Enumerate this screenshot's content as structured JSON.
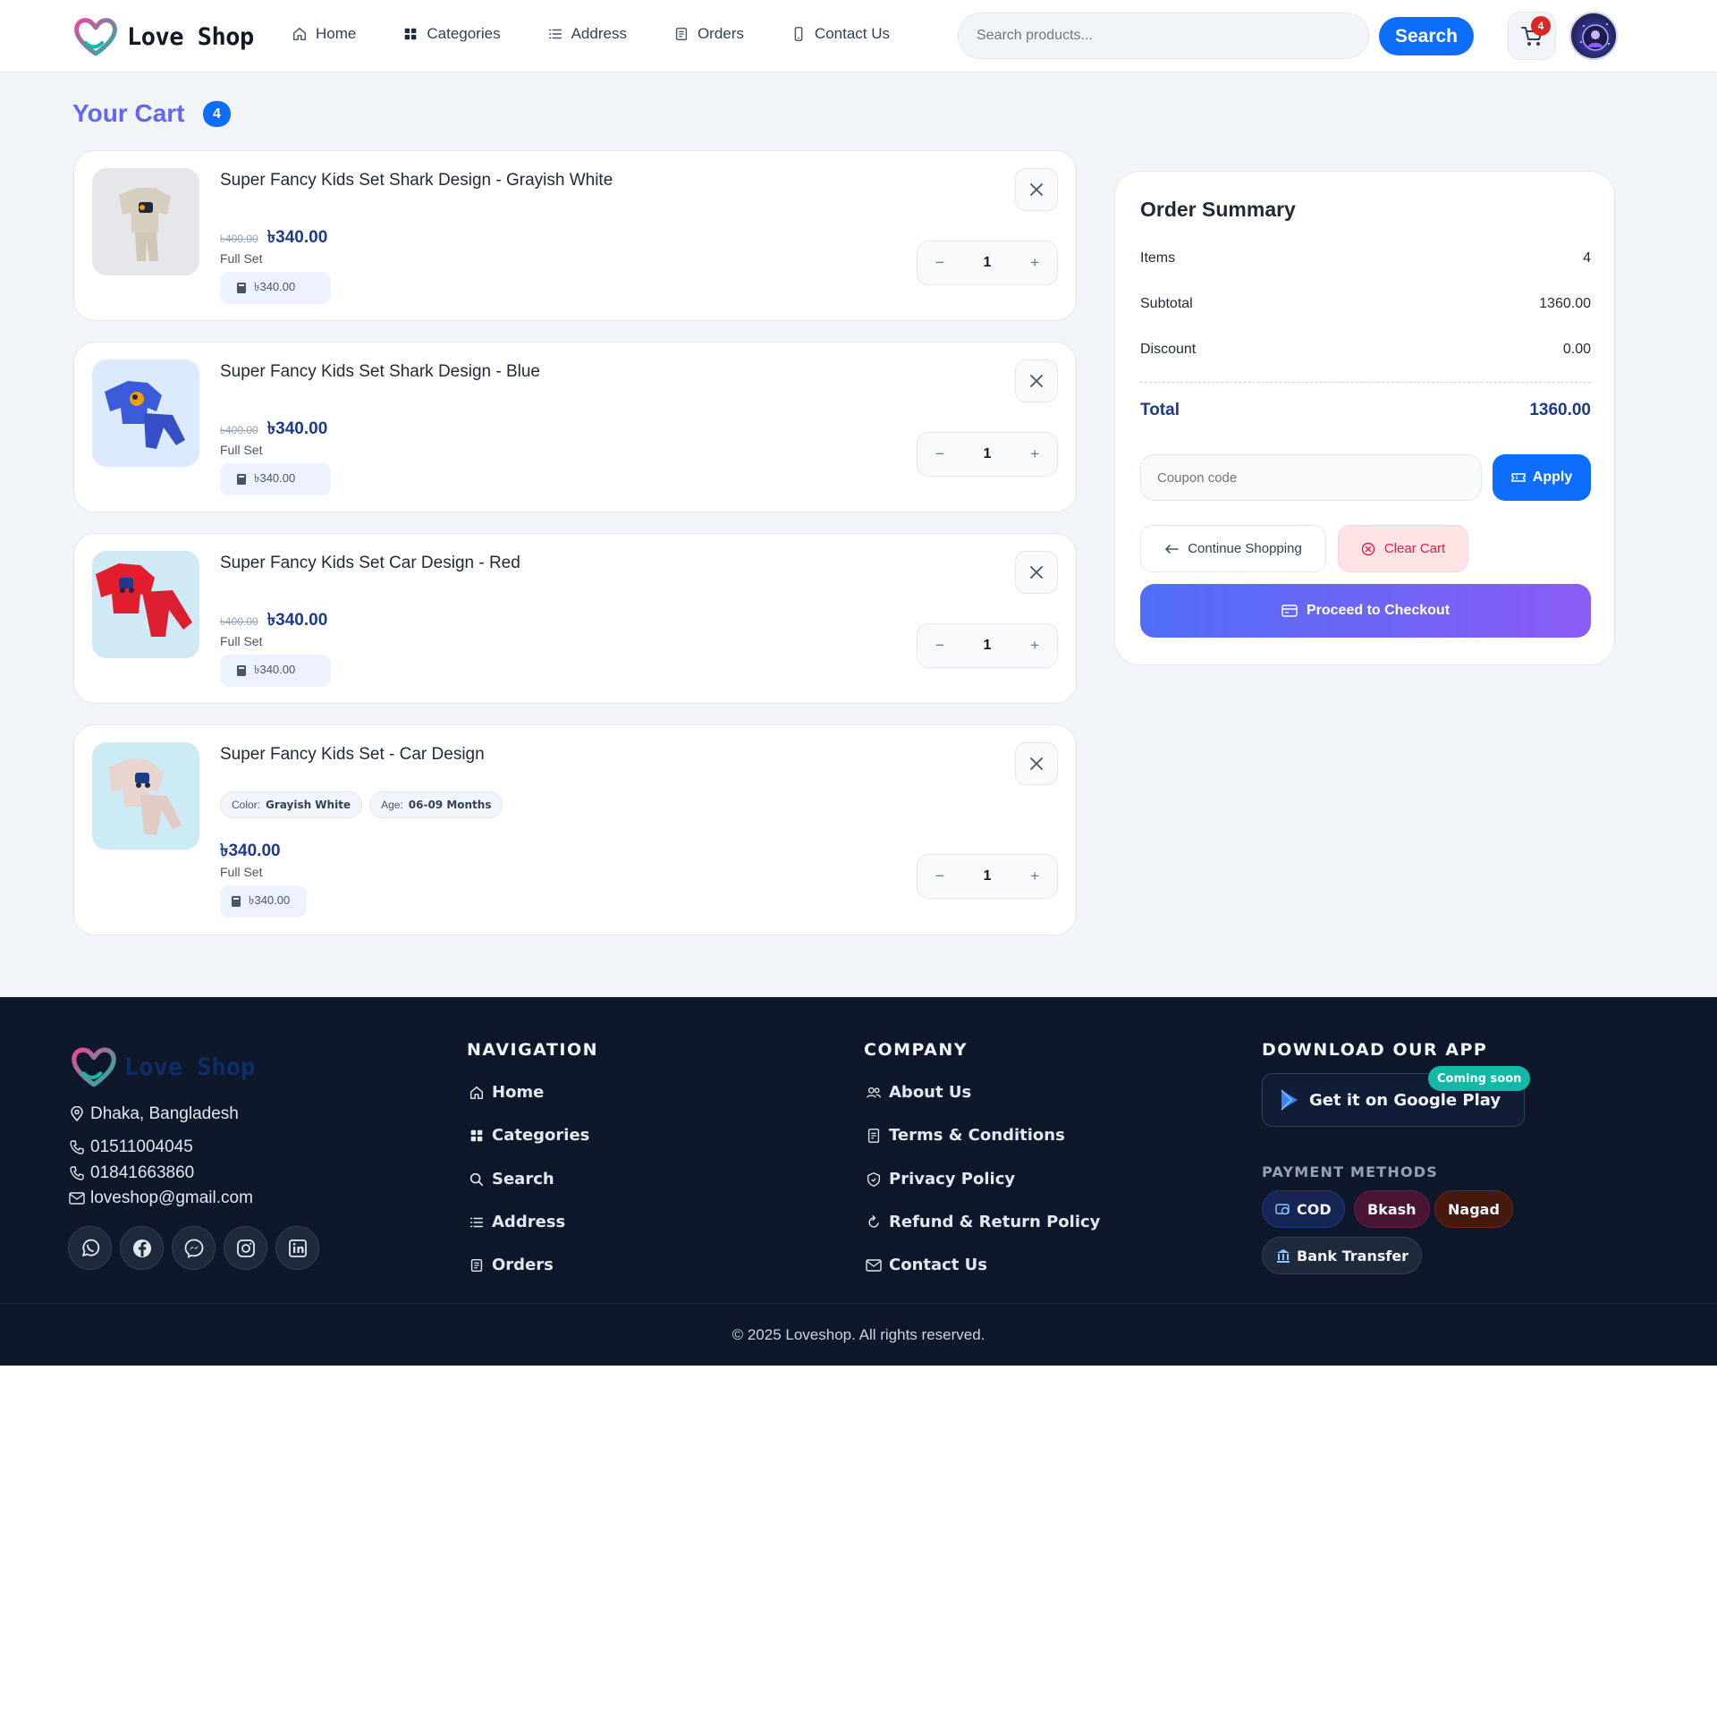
{
  "header": {
    "logo_text": "Love Shop",
    "nav": [
      {
        "label": "Home",
        "icon": "home-icon"
      },
      {
        "label": "Categories",
        "icon": "grid-icon"
      },
      {
        "label": "Address",
        "icon": "list-icon"
      },
      {
        "label": "Orders",
        "icon": "receipt-icon"
      },
      {
        "label": "Contact Us",
        "icon": "phone-icon"
      }
    ],
    "search_placeholder": "Search products...",
    "search_label": "Search",
    "cart_count": "4"
  },
  "cart": {
    "title": "Your Cart",
    "count": "4",
    "items": [
      {
        "name": "Super Fancy Kids Set Shark Design - Grayish White",
        "old_price": "৳400.00",
        "price": "৳340.00",
        "variant": "Full Set",
        "line_total": "৳340.00",
        "qty": "1",
        "qty_minus": "−",
        "qty_plus": "+"
      },
      {
        "name": "Super Fancy Kids Set Shark Design - Blue",
        "old_price": "৳400.00",
        "price": "৳340.00",
        "variant": "Full Set",
        "line_total": "৳340.00",
        "qty": "1",
        "qty_minus": "−",
        "qty_plus": "+"
      },
      {
        "name": "Super Fancy Kids Set Car Design - Red",
        "old_price": "৳400.00",
        "price": "৳340.00",
        "variant": "Full Set",
        "line_total": "৳340.00",
        "qty": "1",
        "qty_minus": "−",
        "qty_plus": "+"
      },
      {
        "name": "Super Fancy Kids Set - Car Design",
        "attrs": [
          {
            "label": "Color:",
            "value": "Grayish White"
          },
          {
            "label": "Age:",
            "value": "06-09 Months"
          }
        ],
        "price": "৳340.00",
        "variant": "Full Set",
        "line_total": "৳340.00",
        "qty": "1",
        "qty_minus": "−",
        "qty_plus": "+"
      }
    ]
  },
  "summary": {
    "title": "Order Summary",
    "items_label": "Items",
    "items_value": "4",
    "subtotal_label": "Subtotal",
    "subtotal_value": "1360.00",
    "discount_label": "Discount",
    "discount_value": "0.00",
    "total_label": "Total",
    "total_value": "1360.00",
    "coupon_placeholder": "Coupon code",
    "apply_label": "Apply",
    "continue_label": "Continue Shopping",
    "clear_label": "Clear Cart",
    "checkout_label": "Proceed to Checkout"
  },
  "footer": {
    "logo_text": "Love Shop",
    "location": "Dhaka, Bangladesh",
    "phone1": "01511004045",
    "phone2": "01841663860",
    "email": "loveshop@gmail.com",
    "socials": [
      "whatsapp-icon",
      "facebook-icon",
      "messenger-icon",
      "instagram-icon",
      "linkedin-icon"
    ],
    "nav_heading": "NAVIGATION",
    "nav_links": [
      "Home",
      "Categories",
      "Search",
      "Address",
      "Orders"
    ],
    "company_heading": "COMPANY",
    "company_links": [
      "About Us",
      "Terms & Conditions",
      "Privacy Policy",
      "Refund & Return Policy",
      "Contact Us"
    ],
    "app_heading": "DOWNLOAD OUR APP",
    "google_play": "Get it on Google Play",
    "coming_soon": "Coming soon",
    "payment_heading": "PAYMENT METHODS",
    "payments": [
      "COD",
      "Bkash",
      "Nagad",
      "Bank Transfer"
    ],
    "copyright": "© 2025 Loveshop. All rights reserved."
  },
  "colors": {
    "primary": "#0d6efd",
    "cart_title": "#6366f1",
    "price": "#1e3a8a",
    "danger": "#e11d48",
    "footer_bg": "#0f172a",
    "checkout_from": "#4f6ef7",
    "checkout_to": "#8b5cf6"
  }
}
